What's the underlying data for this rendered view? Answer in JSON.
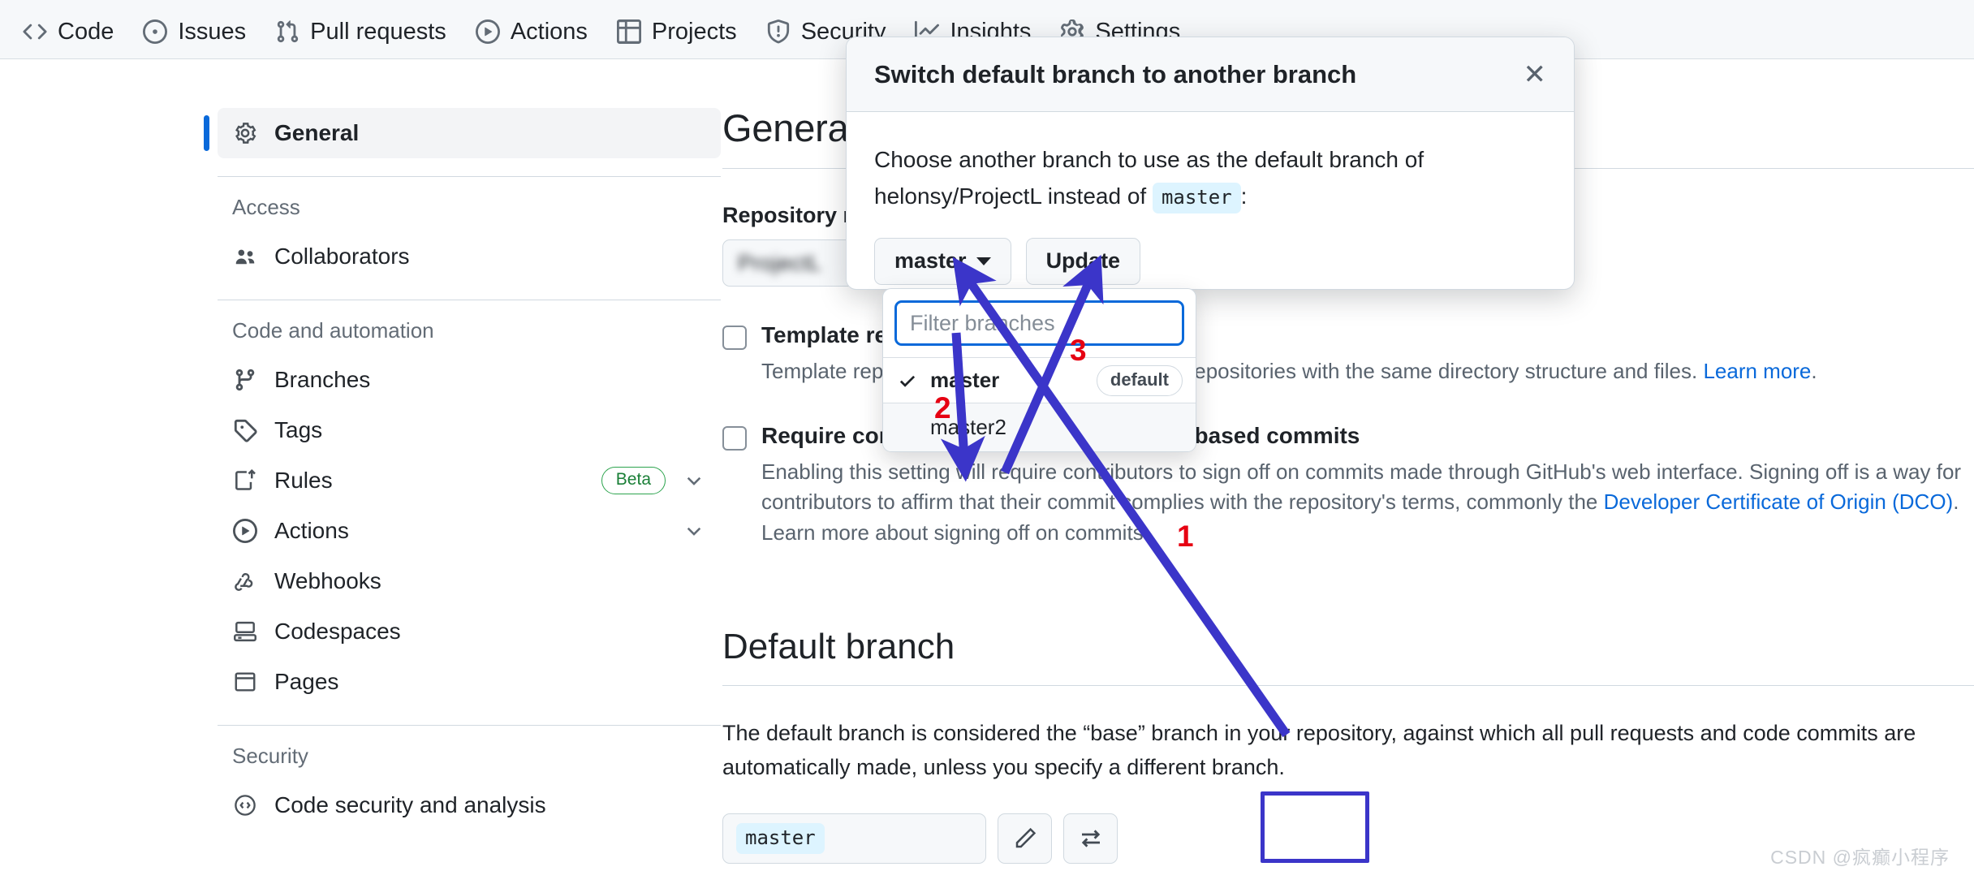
{
  "repo_nav": {
    "items": [
      {
        "label": "Code",
        "icon": "code-icon"
      },
      {
        "label": "Issues",
        "icon": "issue-opened-icon"
      },
      {
        "label": "Pull requests",
        "icon": "git-pull-request-icon"
      },
      {
        "label": "Actions",
        "icon": "play-icon"
      },
      {
        "label": "Projects",
        "icon": "table-icon"
      },
      {
        "label": "Security",
        "icon": "shield-icon"
      },
      {
        "label": "Insights",
        "icon": "graph-icon"
      },
      {
        "label": "Settings",
        "icon": "gear-icon"
      }
    ]
  },
  "sidebar": {
    "active": {
      "label": "General",
      "icon": "gear-icon"
    },
    "groups": [
      {
        "title": "Access",
        "items": [
          {
            "label": "Collaborators",
            "icon": "people-icon",
            "badge": "",
            "chevron": false
          }
        ]
      },
      {
        "title": "Code and automation",
        "items": [
          {
            "label": "Branches",
            "icon": "git-branch-icon",
            "badge": "",
            "chevron": false
          },
          {
            "label": "Tags",
            "icon": "tag-icon",
            "badge": "",
            "chevron": false
          },
          {
            "label": "Rules",
            "icon": "rules-icon",
            "badge": "Beta",
            "chevron": true
          },
          {
            "label": "Actions",
            "icon": "play-icon",
            "badge": "",
            "chevron": true
          },
          {
            "label": "Webhooks",
            "icon": "webhook-icon",
            "badge": "",
            "chevron": false
          },
          {
            "label": "Codespaces",
            "icon": "codespaces-icon",
            "badge": "",
            "chevron": false
          },
          {
            "label": "Pages",
            "icon": "browser-icon",
            "badge": "",
            "chevron": false
          }
        ]
      },
      {
        "title": "Security",
        "items": [
          {
            "label": "Code security and analysis",
            "icon": "code-square-icon",
            "badge": "",
            "chevron": false
          }
        ]
      }
    ]
  },
  "main": {
    "page_title": "General",
    "repository_name_label": "Repository name",
    "repository_name_value": "ProjectL",
    "checkboxes": [
      {
        "title": "Template repository",
        "desc_before": "Template repositories let users generate new repositories with the same directory structure and files. ",
        "link": "Learn more",
        "desc_after": ".",
        "checked": false
      },
      {
        "title": "Require contributors to sign off on web-based commits",
        "desc_before": "Enabling this setting will require contributors to sign off on commits made through GitHub's web interface. Signing off is a way for contributors to affirm that their commit complies with the repository's terms, commonly the ",
        "link": "Developer Certificate of Origin (DCO)",
        "desc_after": ". Learn more about signing off on commits.",
        "checked": false
      }
    ],
    "default_branch": {
      "heading": "Default branch",
      "paragraph": "The default branch is considered the “base” branch in your repository, against which all pull requests and code commits are automatically made, unless you specify a different branch.",
      "current": "master",
      "rename_button_icon": "pencil-icon",
      "switch_button_icon": "switch-icon"
    }
  },
  "modal": {
    "title": "Switch default branch to another branch",
    "close_icon": "close-icon",
    "body_prefix": "Choose another branch to use as the default branch of helonsy/ProjectL instead of",
    "body_code": "master",
    "body_suffix": ":",
    "branch_button_label": "master",
    "update_button_label": "Update"
  },
  "dropdown": {
    "filter_placeholder": "Filter branches",
    "items": [
      {
        "label": "master",
        "selected": true,
        "badge": "default"
      },
      {
        "label": "master2",
        "selected": false,
        "badge": ""
      }
    ]
  },
  "annotations": {
    "numbers": [
      "1",
      "2",
      "3"
    ],
    "arrow_color": "#3b35c9",
    "number_color": "#e60012"
  },
  "watermark": "CSDN @疯癫小程序"
}
